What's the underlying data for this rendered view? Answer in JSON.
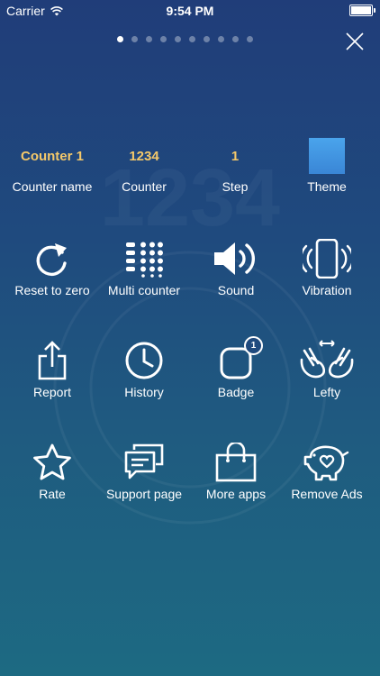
{
  "status_bar": {
    "carrier": "Carrier",
    "time": "9:54 PM"
  },
  "page_indicator": {
    "total": 10,
    "active_index": 0
  },
  "settings": {
    "counter_name": {
      "value": "Counter 1",
      "label": "Counter name"
    },
    "counter": {
      "value": "1234",
      "label": "Counter"
    },
    "step": {
      "value": "1",
      "label": "Step"
    },
    "theme": {
      "label": "Theme",
      "color": "#3f96e0"
    }
  },
  "actions_row1": [
    {
      "label": "Reset to zero",
      "icon": "reset-icon"
    },
    {
      "label": "Multi counter",
      "icon": "multi-counter-icon"
    },
    {
      "label": "Sound",
      "icon": "sound-icon"
    },
    {
      "label": "Vibration",
      "icon": "vibration-icon"
    }
  ],
  "actions_row2": [
    {
      "label": "Report",
      "icon": "share-icon"
    },
    {
      "label": "History",
      "icon": "clock-icon"
    },
    {
      "label": "Badge",
      "icon": "badge-icon",
      "badge_value": "1"
    },
    {
      "label": "Lefty",
      "icon": "hands-icon"
    }
  ],
  "actions_row3": [
    {
      "label": "Rate",
      "icon": "star-icon"
    },
    {
      "label": "Support page",
      "icon": "chat-icon"
    },
    {
      "label": "More apps",
      "icon": "shopping-bag-icon"
    },
    {
      "label": "Remove Ads",
      "icon": "piggy-bank-icon"
    }
  ],
  "accent_color": "#f5c96a"
}
